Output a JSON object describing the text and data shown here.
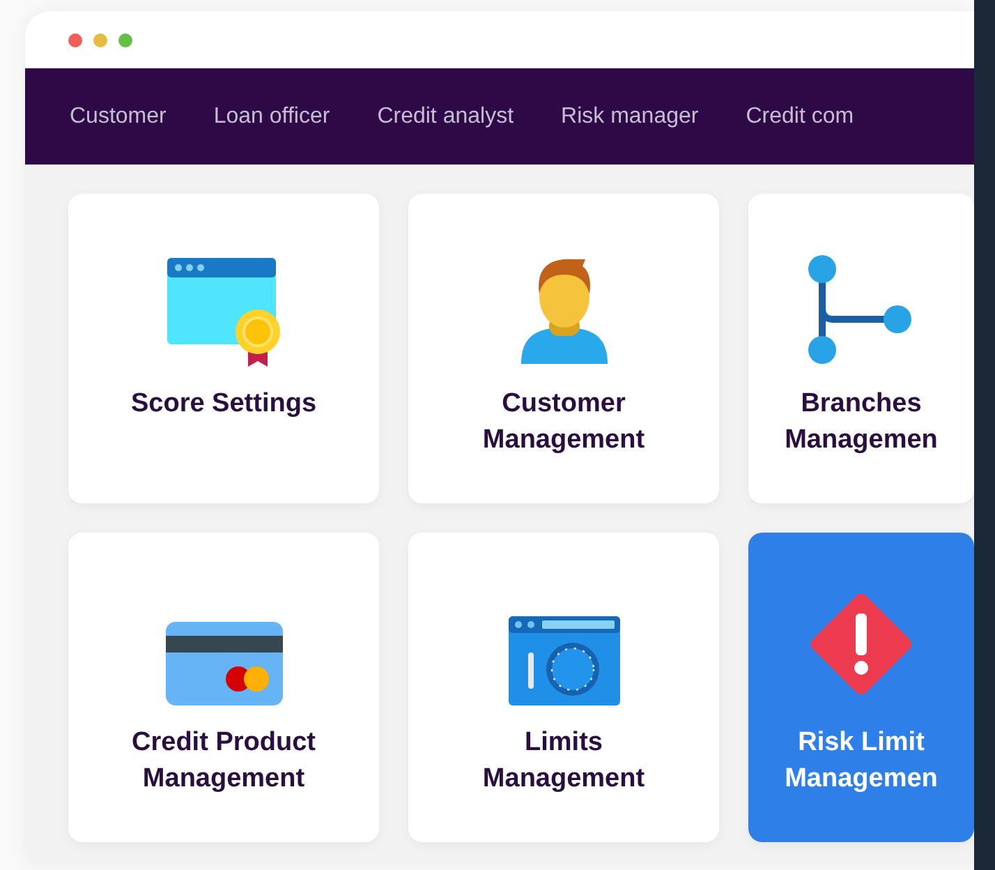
{
  "window": {
    "controls": [
      {
        "color": "#ef5f58"
      },
      {
        "color": "#e2bd3f"
      },
      {
        "color": "#67c046"
      }
    ]
  },
  "nav": {
    "items": [
      {
        "label": "Customer",
        "selected": false
      },
      {
        "label": "Loan officer",
        "selected": false
      },
      {
        "label": "Credit analyst",
        "selected": false
      },
      {
        "label": "Risk manager",
        "selected": false
      },
      {
        "label": "Credit com",
        "selected": false
      }
    ]
  },
  "cards": [
    {
      "kind": "certificate",
      "title": "Score Settings",
      "selected": false
    },
    {
      "kind": "person",
      "title": "Customer Management",
      "selected": false
    },
    {
      "kind": "branch",
      "title": "Branches Managemen",
      "selected": false
    },
    {
      "kind": "card",
      "title": "Credit Product Management",
      "selected": false
    },
    {
      "kind": "safe",
      "title": "Limits Management",
      "selected": false
    },
    {
      "kind": "warning",
      "title": "Risk Limit Managemen",
      "selected": true
    }
  ]
}
